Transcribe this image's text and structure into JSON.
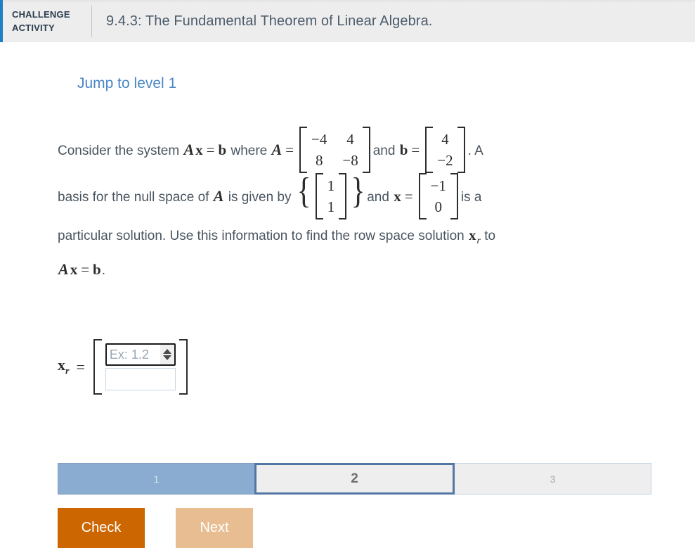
{
  "header": {
    "challenge_label_line1": "CHALLENGE",
    "challenge_label_line2": "ACTIVITY",
    "activity_title": "9.4.3: The Fundamental Theorem of Linear Algebra.",
    "accent_color": "#1f7fc4"
  },
  "jump_to_level": "Jump to level 1",
  "problem": {
    "t1": "Consider the system ",
    "A1": "A",
    "x1": "x",
    "eq1": "=",
    "b1": "b",
    "t2": " where ",
    "A2": "A",
    "eq2": "=",
    "matrix_A": [
      "−4",
      "4",
      "8",
      "−8"
    ],
    "t3": "and ",
    "b2": "b",
    "eq3": "=",
    "vector_b": [
      "4",
      "−2"
    ],
    "t4": ". A",
    "t5": "basis for the null space of ",
    "A3": "A",
    "t6": " is given by ",
    "nullspace_basis": [
      "1",
      "1"
    ],
    "t7": "and ",
    "x2": "x",
    "eq4": "=",
    "vector_x": [
      "−1",
      "0"
    ],
    "t8": "is a",
    "t9": "particular solution. Use this information to find the row space solution ",
    "xr1": "x",
    "xr1_sub": "r",
    "t10": " to",
    "A4": "A",
    "x3": "x",
    "eq5": "=",
    "b3": "b",
    "t11": "."
  },
  "answer": {
    "label_main": "x",
    "label_sub": "r",
    "equals": "=",
    "field1_value": "",
    "field1_placeholder": "Ex: 1.2",
    "field2_value": "",
    "field2_placeholder": ""
  },
  "levels": [
    {
      "label": "1",
      "state": "done"
    },
    {
      "label": "2",
      "state": "current"
    },
    {
      "label": "3",
      "state": "todo"
    }
  ],
  "buttons": {
    "check": "Check",
    "next": "Next",
    "check_color": "#cc6600",
    "next_color": "#e8bd91"
  }
}
